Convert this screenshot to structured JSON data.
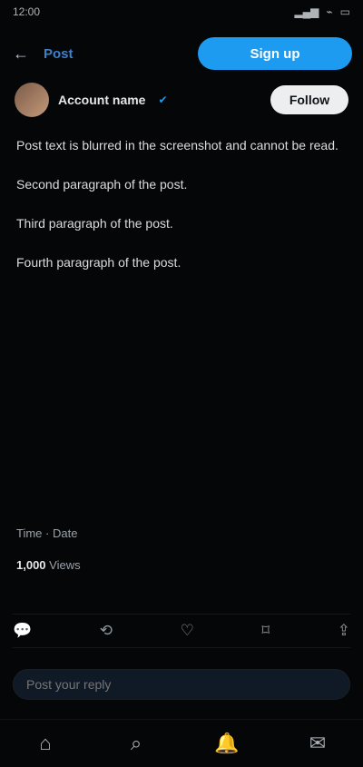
{
  "status_bar": {
    "time": "12:00",
    "right_icons": [
      "signal-icon",
      "wifi-icon",
      "battery-icon"
    ]
  },
  "nav": {
    "back_icon": "back-arrow-icon",
    "title": "Post",
    "primary_action": "Sign up"
  },
  "author": {
    "name": "Account name",
    "verified_icon": "verified-badge-icon",
    "follow_label": "Follow"
  },
  "post": {
    "paragraphs": [
      "Post text is blurred in the screenshot and cannot be read.",
      "Second paragraph of the post.",
      "Third paragraph of the post.",
      "Fourth paragraph of the post."
    ]
  },
  "meta": {
    "timestamp": "Time · Date",
    "views_count": "1,000",
    "views_label": "Views"
  },
  "actions": {
    "reply": {
      "icon": "reply-icon",
      "count": ""
    },
    "repost": {
      "icon": "repost-icon",
      "count": ""
    },
    "like": {
      "icon": "like-icon",
      "count": ""
    },
    "bookmark": {
      "icon": "bookmark-icon",
      "count": ""
    },
    "share": {
      "icon": "share-icon",
      "count": ""
    }
  },
  "reply_input": {
    "placeholder": "Post your reply"
  },
  "tabbar": {
    "items": [
      "home-icon",
      "search-icon",
      "notifications-icon",
      "messages-icon"
    ]
  },
  "colors": {
    "background": "#050607",
    "accent": "#1d9bf0",
    "text": "#e9eaeb",
    "muted": "#8f98a0"
  }
}
